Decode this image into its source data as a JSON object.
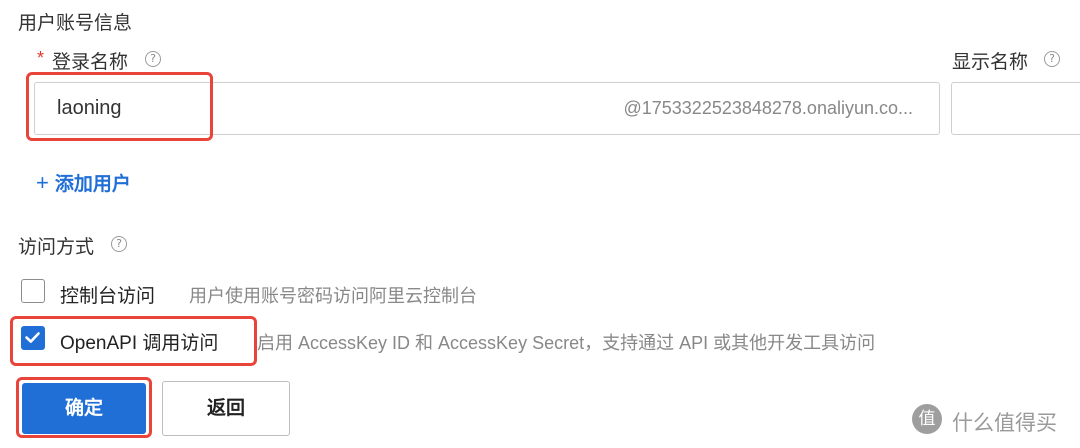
{
  "section": {
    "title": "用户账号信息"
  },
  "form": {
    "login_name_required_mark": "*",
    "login_name_label": "登录名称",
    "login_name_value": "laoning",
    "login_name_suffix": "@1753322523848278.onaliyun.co...",
    "display_name_label": "显示名称",
    "add_user_label": "添加用户"
  },
  "access": {
    "title": "访问方式",
    "console": {
      "label": "控制台访问",
      "desc": "用户使用账号密码访问阿里云控制台",
      "checked": false
    },
    "openapi": {
      "label": "OpenAPI 调用访问",
      "desc": "启用 AccessKey ID 和 AccessKey Secret，支持通过 API 或其他开发工具访问",
      "checked": true
    }
  },
  "buttons": {
    "confirm": "确定",
    "back": "返回"
  },
  "watermark": {
    "text": "什么值得买",
    "badge": "值"
  },
  "colors": {
    "primary": "#1f6fd6",
    "required": "#e0382b",
    "highlight": "#e8443a",
    "link": "#1f6fd6"
  }
}
